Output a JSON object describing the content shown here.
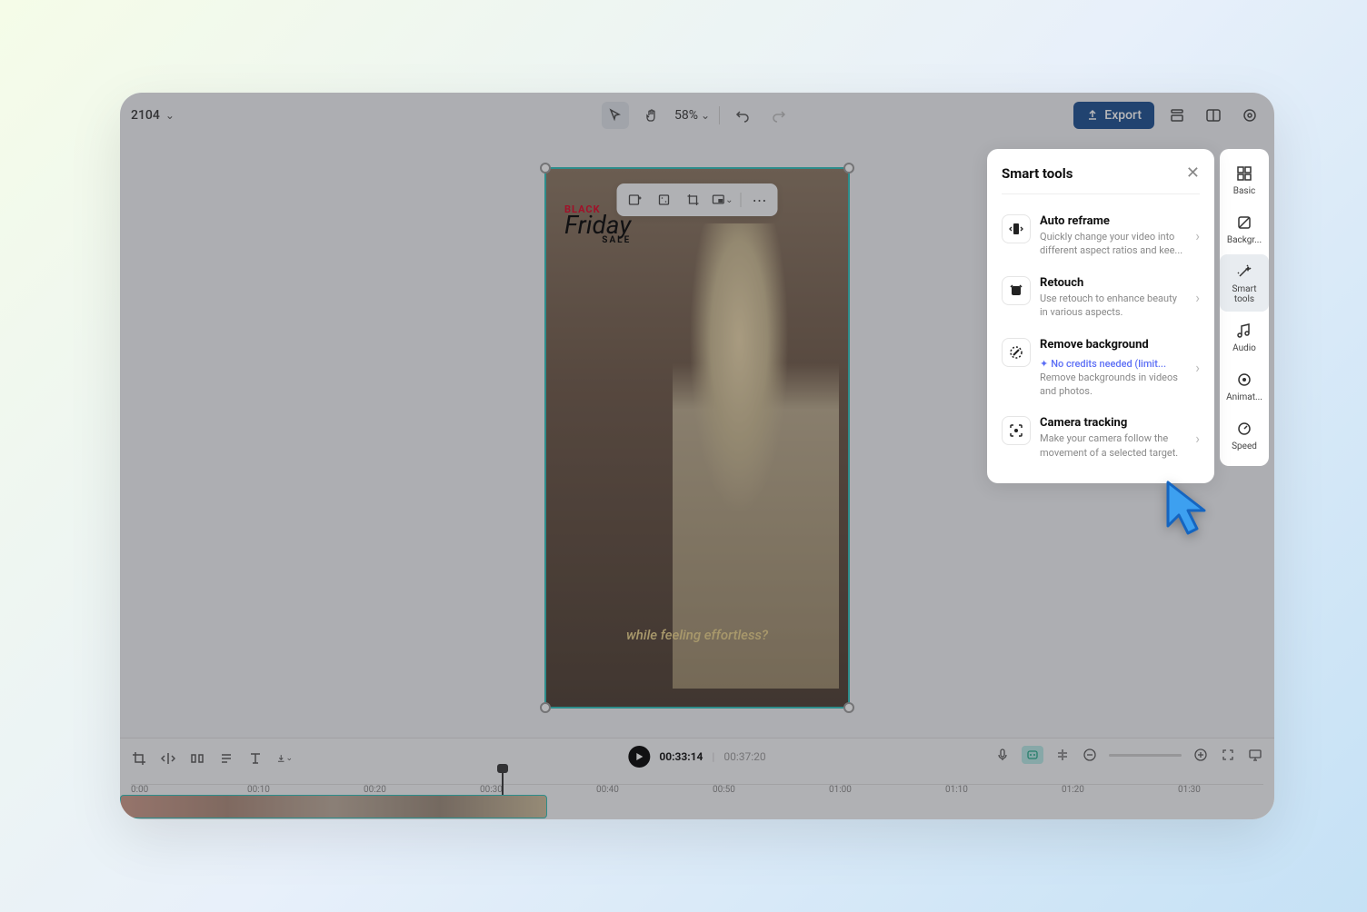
{
  "topbar": {
    "project_id": "2104",
    "zoom": "58%",
    "export_label": "Export"
  },
  "canvas": {
    "badge_top": "BLACK",
    "badge_main": "Friday",
    "badge_sub": "SALE",
    "caption": "while feeling effortless?"
  },
  "sidebar": {
    "items": [
      {
        "label": "Basic",
        "icon": "grid"
      },
      {
        "label": "Backgr...",
        "icon": "diag"
      },
      {
        "label": "Smart tools",
        "icon": "wand"
      },
      {
        "label": "Audio",
        "icon": "music"
      },
      {
        "label": "Animat...",
        "icon": "circle"
      },
      {
        "label": "Speed",
        "icon": "gauge"
      }
    ]
  },
  "panel": {
    "title": "Smart tools",
    "tools": [
      {
        "title": "Auto reframe",
        "desc": "Quickly change your video into different aspect ratios and kee..."
      },
      {
        "title": "Retouch",
        "desc": "Use retouch to enhance beauty in various aspects."
      },
      {
        "title": "Remove background",
        "badge": "No credits needed (limit...",
        "desc": "Remove backgrounds in videos and photos."
      },
      {
        "title": "Camera tracking",
        "desc": "Make your camera follow the movement of a selected target."
      }
    ]
  },
  "timeline": {
    "current": "00:33:14",
    "total": "00:37:20",
    "ruler": [
      "0:00",
      "00:10",
      "00:20",
      "00:30",
      "00:40",
      "00:50",
      "01:00",
      "01:10",
      "01:20",
      "01:30"
    ]
  }
}
